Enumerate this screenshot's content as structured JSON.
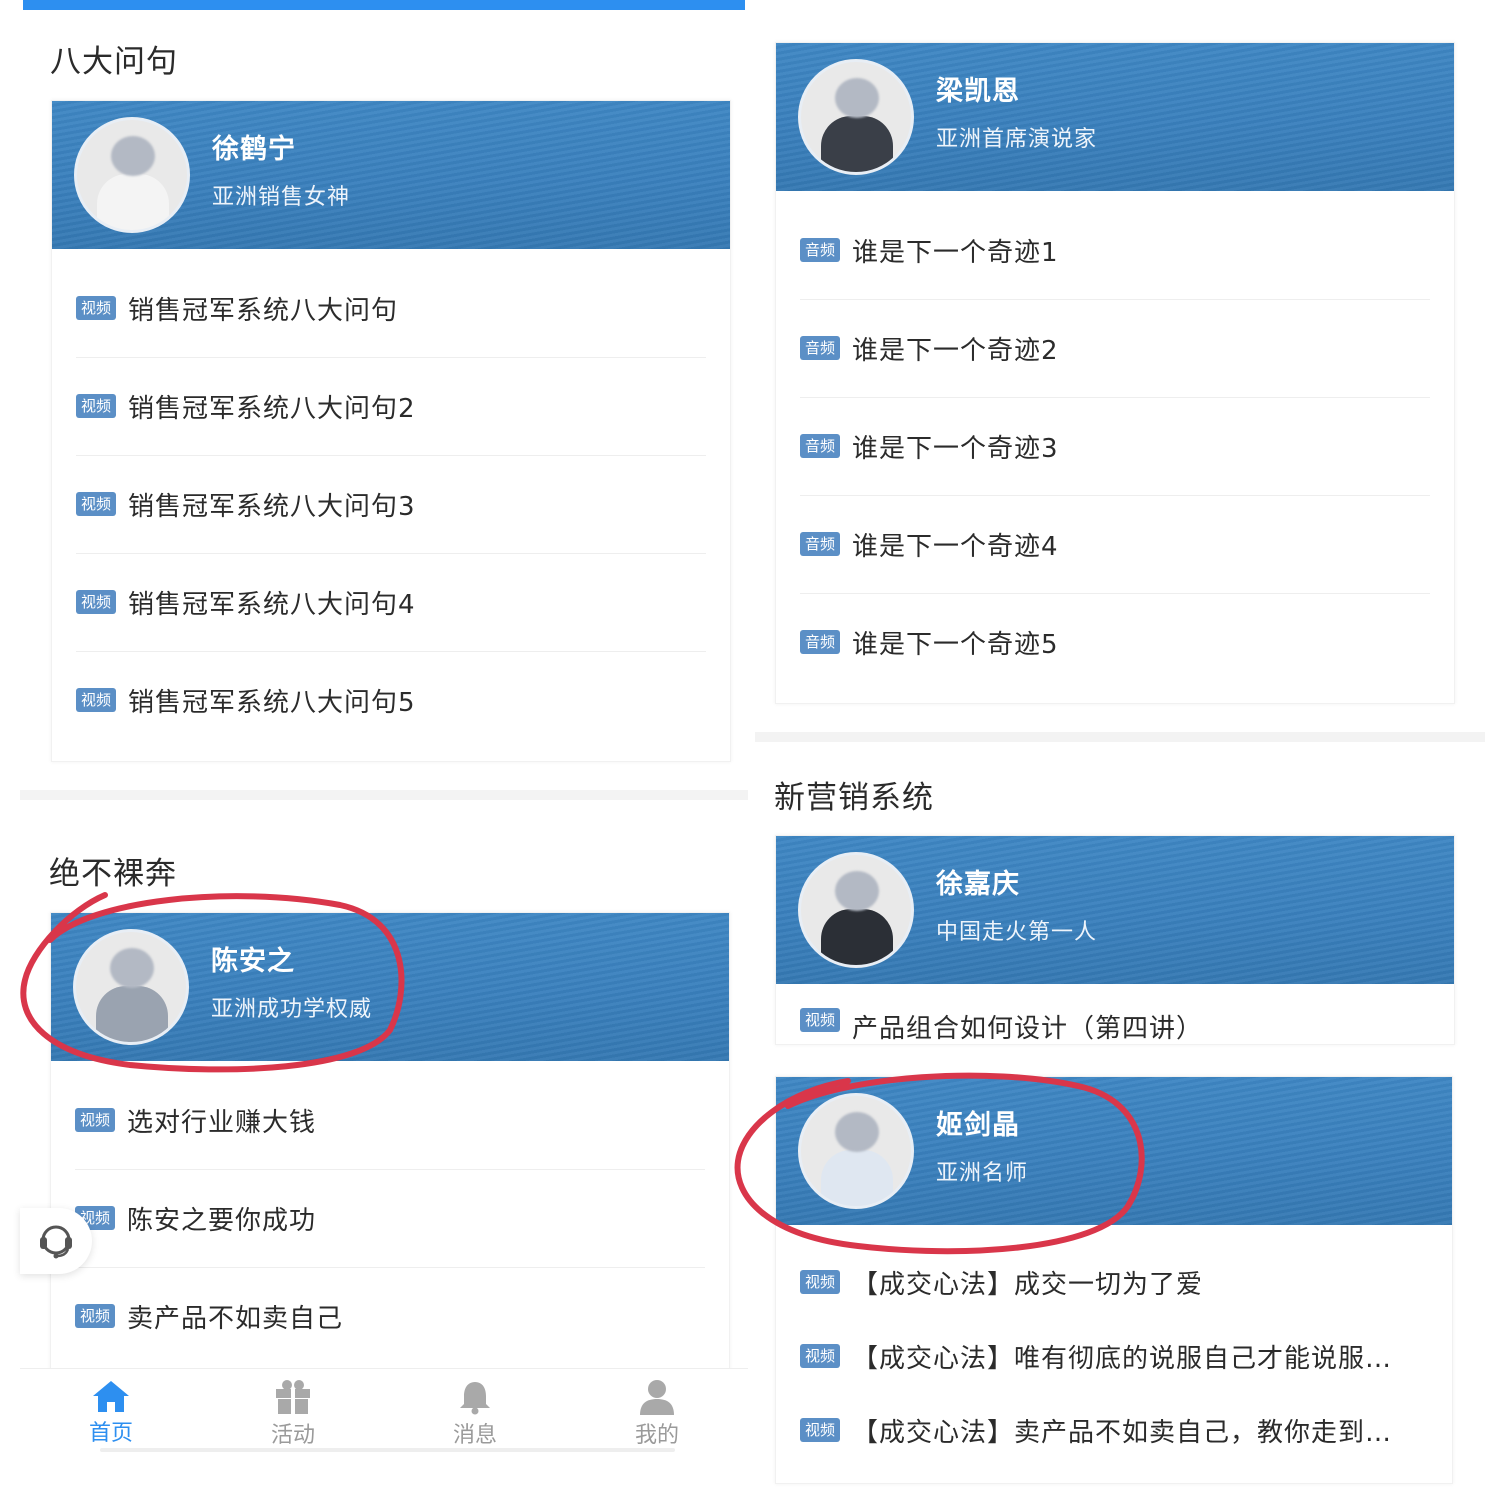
{
  "left": {
    "section1": {
      "title": "八大问句",
      "teacher": {
        "name": "徐鹤宁",
        "title": "亚洲销售女神"
      },
      "items": [
        {
          "tag": "视频",
          "text": "销售冠军系统八大问句"
        },
        {
          "tag": "视频",
          "text": "销售冠军系统八大问句2"
        },
        {
          "tag": "视频",
          "text": "销售冠军系统八大问句3"
        },
        {
          "tag": "视频",
          "text": "销售冠军系统八大问句4"
        },
        {
          "tag": "视频",
          "text": "销售冠军系统八大问句5"
        }
      ]
    },
    "section2": {
      "title": "绝不裸奔",
      "teacher": {
        "name": "陈安之",
        "title": "亚洲成功学权威"
      },
      "items": [
        {
          "tag": "视频",
          "text": "选对行业赚大钱"
        },
        {
          "tag": "视频",
          "text": "陈安之要你成功"
        },
        {
          "tag": "视频",
          "text": "卖产品不如卖自己"
        }
      ]
    },
    "tabbar": [
      {
        "label": "首页",
        "icon": "home-icon",
        "active": true
      },
      {
        "label": "活动",
        "icon": "gift-icon",
        "active": false
      },
      {
        "label": "消息",
        "icon": "bell-icon",
        "active": false
      },
      {
        "label": "我的",
        "icon": "user-icon",
        "active": false
      }
    ]
  },
  "right": {
    "section1": {
      "teacher": {
        "name": "梁凯恩",
        "title": "亚洲首席演说家"
      },
      "items": [
        {
          "tag": "音频",
          "text": "谁是下一个奇迹1"
        },
        {
          "tag": "音频",
          "text": "谁是下一个奇迹2"
        },
        {
          "tag": "音频",
          "text": "谁是下一个奇迹3"
        },
        {
          "tag": "音频",
          "text": "谁是下一个奇迹4"
        },
        {
          "tag": "音频",
          "text": "谁是下一个奇迹5"
        }
      ]
    },
    "section2": {
      "title": "新营销系统",
      "teacher": {
        "name": "徐嘉庆",
        "title": "中国走火第一人"
      },
      "partial_item": {
        "tag": "视频",
        "text": "产品组合如何设计（第四讲）"
      }
    },
    "section3": {
      "teacher": {
        "name": "姬剑晶",
        "title": "亚洲名师"
      },
      "items": [
        {
          "tag": "视频",
          "text": "【成交心法】成交一切为了爱"
        },
        {
          "tag": "视频",
          "text": "【成交心法】唯有彻底的说服自己才能说服…"
        },
        {
          "tag": "视频",
          "text": "【成交心法】卖产品不如卖自己，教你走到…"
        }
      ]
    }
  },
  "colors": {
    "accent": "#2d8ff0",
    "banner": "#3a80bd",
    "tag": "#5b8fc6",
    "annotation": "#d9364a"
  }
}
